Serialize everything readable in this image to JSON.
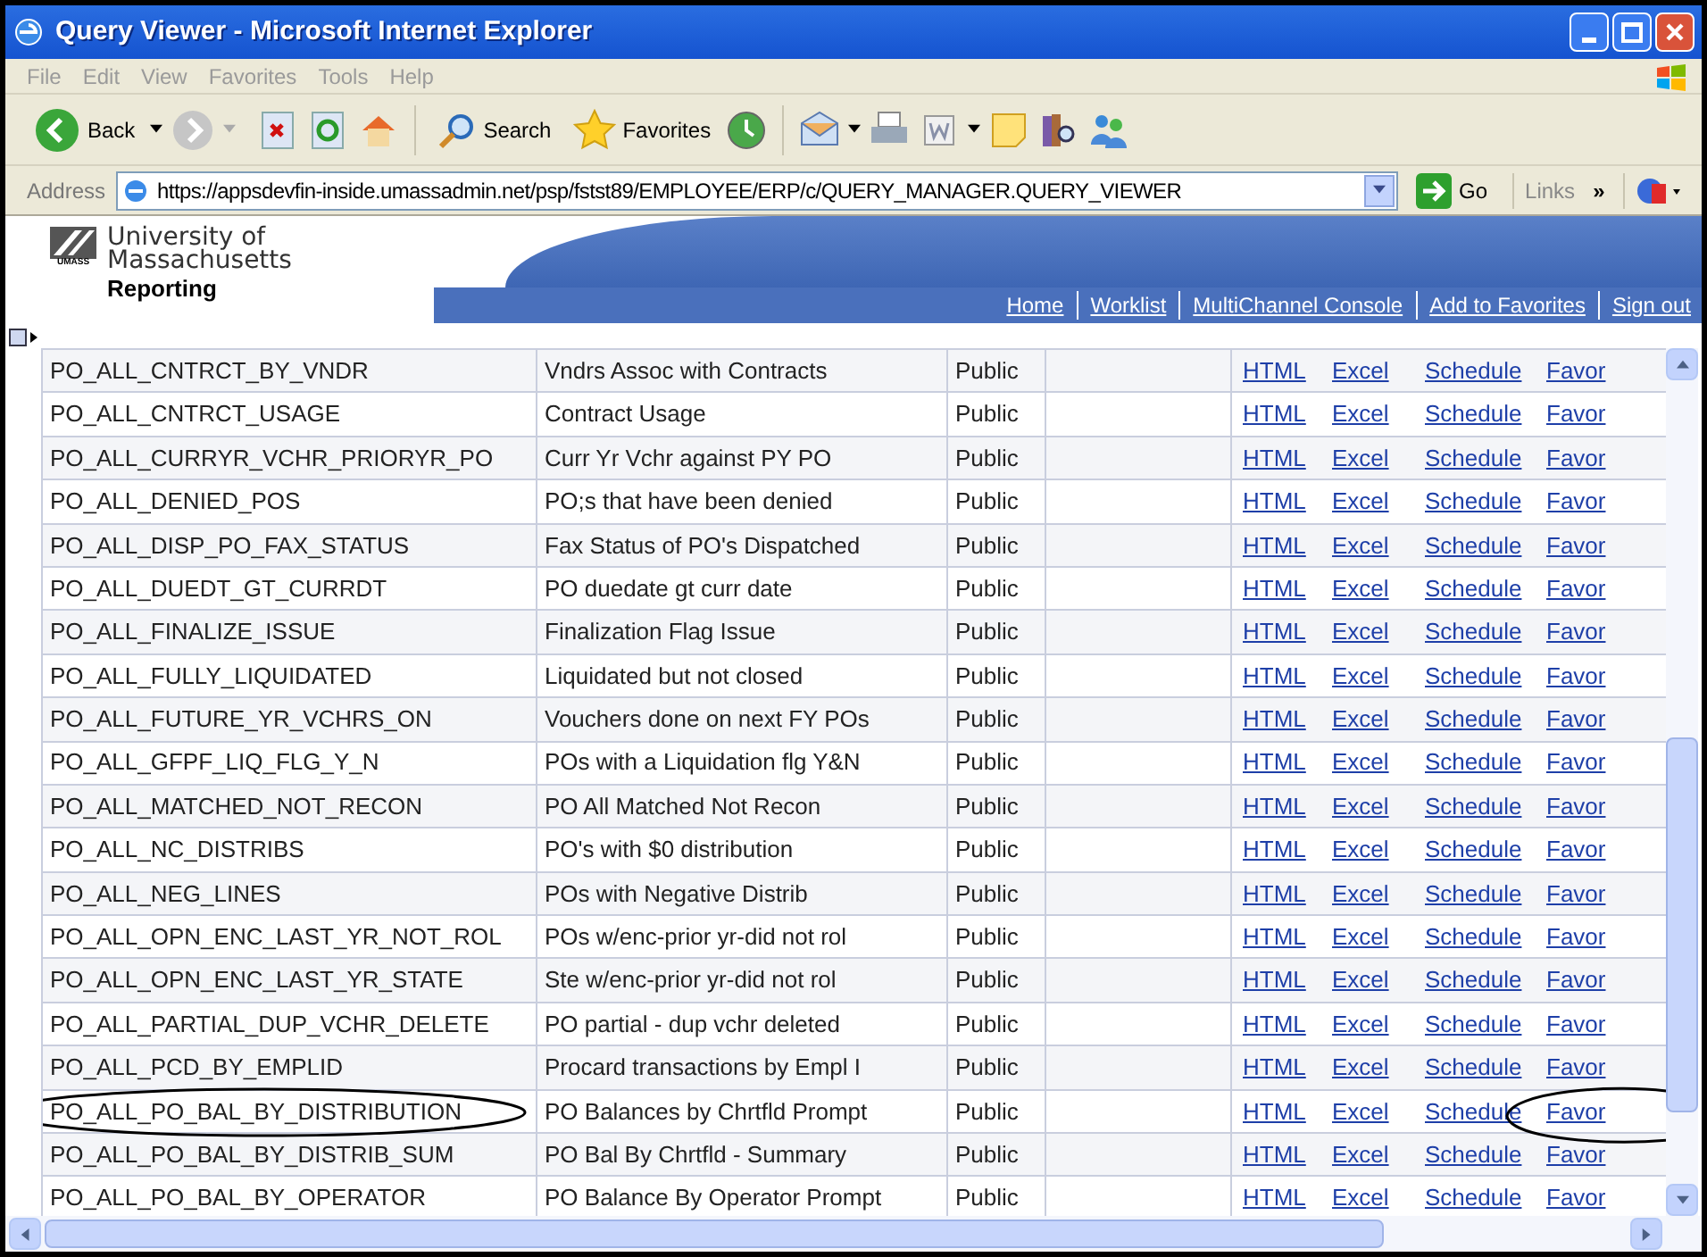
{
  "window": {
    "title": "Query Viewer - Microsoft Internet Explorer"
  },
  "menu": [
    "File",
    "Edit",
    "View",
    "Favorites",
    "Tools",
    "Help"
  ],
  "toolbar": {
    "back": "Back",
    "search": "Search",
    "favorites": "Favorites"
  },
  "address": {
    "label": "Address",
    "url": "https://appsdevfin-inside.umassadmin.net/psp/fstst89/EMPLOYEE/ERP/c/QUERY_MANAGER.QUERY_VIEWER",
    "go": "Go",
    "links": "Links",
    "more": "»"
  },
  "header": {
    "org_line1": "University of",
    "org_line2": "Massachusetts",
    "app": "Reporting",
    "logo_small": "UMASS",
    "nav": [
      "Home",
      "Worklist",
      "MultiChannel Console",
      "Add to Favorites",
      "Sign out"
    ]
  },
  "rows": [
    {
      "name": "PO_ALL_CNTRCT_BY_VNDR",
      "description": "Vndrs Assoc with Contracts",
      "access": "Public",
      "html": "HTML",
      "excel": "Excel",
      "schedule": "Schedule",
      "favorite": "Favor",
      "circled": false
    },
    {
      "name": "PO_ALL_CNTRCT_USAGE",
      "description": "Contract Usage",
      "access": "Public",
      "html": "HTML",
      "excel": "Excel",
      "schedule": "Schedule",
      "favorite": "Favor",
      "circled": false
    },
    {
      "name": "PO_ALL_CURRYR_VCHR_PRIORYR_PO",
      "description": "Curr Yr Vchr against PY PO",
      "access": "Public",
      "html": "HTML",
      "excel": "Excel",
      "schedule": "Schedule",
      "favorite": "Favor",
      "circled": false
    },
    {
      "name": "PO_ALL_DENIED_POS",
      "description": "PO;s that have been denied",
      "access": "Public",
      "html": "HTML",
      "excel": "Excel",
      "schedule": "Schedule",
      "favorite": "Favor",
      "circled": false
    },
    {
      "name": "PO_ALL_DISP_PO_FAX_STATUS",
      "description": "Fax Status of PO's Dispatched",
      "access": "Public",
      "html": "HTML",
      "excel": "Excel",
      "schedule": "Schedule",
      "favorite": "Favor",
      "circled": false
    },
    {
      "name": "PO_ALL_DUEDT_GT_CURRDT",
      "description": "PO duedate gt curr date",
      "access": "Public",
      "html": "HTML",
      "excel": "Excel",
      "schedule": "Schedule",
      "favorite": "Favor",
      "circled": false
    },
    {
      "name": "PO_ALL_FINALIZE_ISSUE",
      "description": "Finalization Flag Issue",
      "access": "Public",
      "html": "HTML",
      "excel": "Excel",
      "schedule": "Schedule",
      "favorite": "Favor",
      "circled": false
    },
    {
      "name": "PO_ALL_FULLY_LIQUIDATED",
      "description": "Liquidated but not closed",
      "access": "Public",
      "html": "HTML",
      "excel": "Excel",
      "schedule": "Schedule",
      "favorite": "Favor",
      "circled": false
    },
    {
      "name": "PO_ALL_FUTURE_YR_VCHRS_ON",
      "description": "Vouchers done on next FY POs",
      "access": "Public",
      "html": "HTML",
      "excel": "Excel",
      "schedule": "Schedule",
      "favorite": "Favor",
      "circled": false
    },
    {
      "name": "PO_ALL_GFPF_LIQ_FLG_Y_N",
      "description": "POs with a Liquidation flg Y&N",
      "access": "Public",
      "html": "HTML",
      "excel": "Excel",
      "schedule": "Schedule",
      "favorite": "Favor",
      "circled": false
    },
    {
      "name": "PO_ALL_MATCHED_NOT_RECON",
      "description": "PO All Matched Not Recon",
      "access": "Public",
      "html": "HTML",
      "excel": "Excel",
      "schedule": "Schedule",
      "favorite": "Favor",
      "circled": false
    },
    {
      "name": "PO_ALL_NC_DISTRIBS",
      "description": "PO's with $0 distribution",
      "access": "Public",
      "html": "HTML",
      "excel": "Excel",
      "schedule": "Schedule",
      "favorite": "Favor",
      "circled": false
    },
    {
      "name": "PO_ALL_NEG_LINES",
      "description": "POs with Negative Distrib",
      "access": "Public",
      "html": "HTML",
      "excel": "Excel",
      "schedule": "Schedule",
      "favorite": "Favor",
      "circled": false
    },
    {
      "name": "PO_ALL_OPN_ENC_LAST_YR_NOT_ROL",
      "description": "POs w/enc-prior yr-did not rol",
      "access": "Public",
      "html": "HTML",
      "excel": "Excel",
      "schedule": "Schedule",
      "favorite": "Favor",
      "circled": false
    },
    {
      "name": "PO_ALL_OPN_ENC_LAST_YR_STATE",
      "description": "Ste w/enc-prior yr-did not rol",
      "access": "Public",
      "html": "HTML",
      "excel": "Excel",
      "schedule": "Schedule",
      "favorite": "Favor",
      "circled": false
    },
    {
      "name": "PO_ALL_PARTIAL_DUP_VCHR_DELETE",
      "description": "PO partial - dup vchr deleted",
      "access": "Public",
      "html": "HTML",
      "excel": "Excel",
      "schedule": "Schedule",
      "favorite": "Favor",
      "circled": false
    },
    {
      "name": "PO_ALL_PCD_BY_EMPLID",
      "description": "Procard transactions by Empl I",
      "access": "Public",
      "html": "HTML",
      "excel": "Excel",
      "schedule": "Schedule",
      "favorite": "Favor",
      "circled": false
    },
    {
      "name": "PO_ALL_PO_BAL_BY_DISTRIBUTION",
      "description": "PO Balances by Chrtfld Prompt",
      "access": "Public",
      "html": "HTML",
      "excel": "Excel",
      "schedule": "Schedule",
      "favorite": "Favor",
      "circled": true
    },
    {
      "name": "PO_ALL_PO_BAL_BY_DISTRIB_SUM",
      "description": "PO Bal By Chrtfld - Summary",
      "access": "Public",
      "html": "HTML",
      "excel": "Excel",
      "schedule": "Schedule",
      "favorite": "Favor",
      "circled": false
    },
    {
      "name": "PO_ALL_PO_BAL_BY_OPERATOR",
      "description": "PO Balance By Operator Prompt",
      "access": "Public",
      "html": "HTML",
      "excel": "Excel",
      "schedule": "Schedule",
      "favorite": "Favor",
      "circled": false
    }
  ]
}
